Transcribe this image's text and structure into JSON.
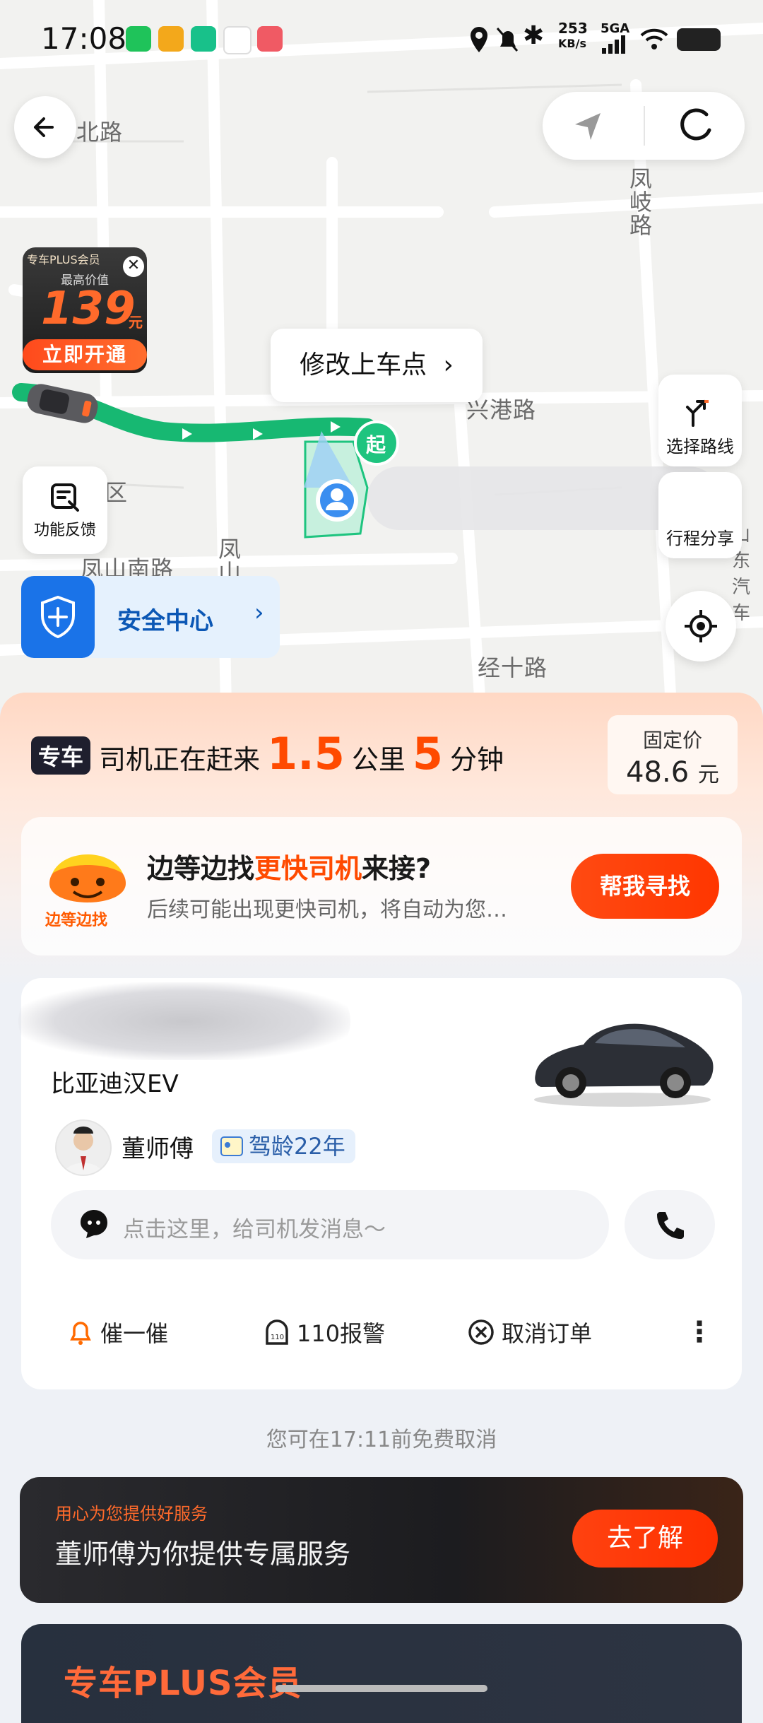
{
  "status_bar": {
    "time": "17:08",
    "speed_value": "253",
    "speed_unit": "KB/s",
    "network": "5GA"
  },
  "map": {
    "road_labels": [
      "北路",
      "凤岐路",
      "兴港路",
      "区",
      "凤山南路",
      "凤山",
      "经十路",
      "山东汽车"
    ],
    "start_marker": "起",
    "pickup_edit": "修改上车点",
    "select_route": "选择路线",
    "trip_share": "行程分享",
    "feedback": "功能反馈",
    "safety_center": "安全中心"
  },
  "promo": {
    "tag": "专车PLUS会员",
    "subtitle": "最高价值",
    "amount": "139",
    "unit": "元",
    "cta": "立即开通"
  },
  "trip_status": {
    "badge": "专车",
    "prefix": "司机正在赶来",
    "distance": "1.5",
    "distance_unit": "公里",
    "minutes": "5",
    "minutes_unit": "分钟",
    "fixed_price_label": "固定价",
    "fixed_price": "48.6",
    "fixed_price_unit": "元"
  },
  "wait_card": {
    "logo_text": "边等边找",
    "title_a": "边等边找",
    "title_hl": "更快司机",
    "title_b": "来接?",
    "desc": "后续可能出现更快司机，将自动为您…",
    "button": "帮我寻找"
  },
  "driver": {
    "car_model": "比亚迪汉EV",
    "name": "董师傅",
    "driving_age": "驾龄22年",
    "message_placeholder": "点击这里，给司机发消息～",
    "actions": {
      "urge": "催一催",
      "police": "110报警",
      "cancel": "取消订单"
    }
  },
  "free_cancel": "您可在17:11前免费取消",
  "service": {
    "subtitle": "用心为您提供好服务",
    "title": "董师傅为你提供专属服务",
    "button": "去了解"
  },
  "plus_banner": {
    "title": "专车PLUS会员"
  },
  "colors": {
    "route": "#1ec47f",
    "accent": "#ff4a00",
    "safety_blue": "#1a73e8"
  }
}
